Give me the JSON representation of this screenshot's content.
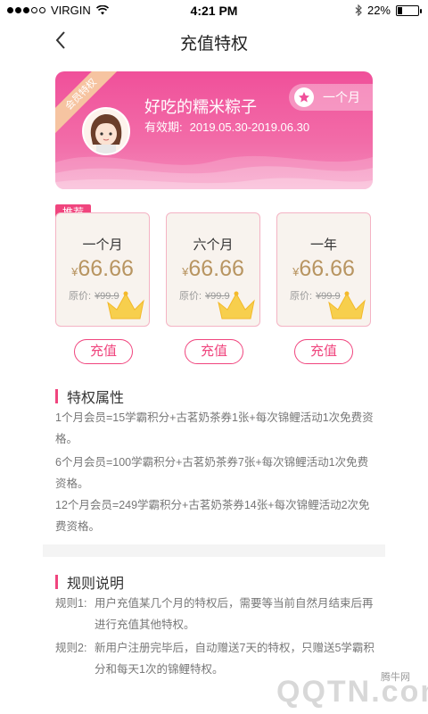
{
  "status": {
    "carrier": "VIRGIN",
    "time": "4:21 PM",
    "battery": "22%",
    "battery_level": 0.22
  },
  "nav": {
    "title": "充值特权"
  },
  "card": {
    "ribbon": "会员特权",
    "name": "好吃的糯米粽子",
    "valid_label": "有效期:",
    "valid_range": "2019.05.30-2019.06.30",
    "plan_label": "一个月"
  },
  "badge": "推荐",
  "plans": [
    {
      "name": "一个月",
      "currency": "¥",
      "price": "66.66",
      "orig_label": "原价:",
      "orig_price": "¥99.9",
      "button": "充值"
    },
    {
      "name": "六个月",
      "currency": "¥",
      "price": "66.66",
      "orig_label": "原价:",
      "orig_price": "¥99.9",
      "button": "充值"
    },
    {
      "name": "一年",
      "currency": "¥",
      "price": "66.66",
      "orig_label": "原价:",
      "orig_price": "¥99.9",
      "button": "充值"
    }
  ],
  "benefits": {
    "title": "特权属性",
    "lines": [
      "1个月会员=15学霸积分+古茗奶茶券1张+每次锦鲤活动1次免费资格。",
      "6个月会员=100学霸积分+古茗奶茶券7张+每次锦鲤活动1次免费资格。",
      "12个月会员=249学霸积分+古茗奶茶券14张+每次锦鲤活动2次免费资格。"
    ]
  },
  "rules": {
    "title": "规则说明",
    "items": [
      {
        "label": "规则1:",
        "text": "用户充值某几个月的特权后，需要等当前自然月结束后再进行充值其他特权。"
      },
      {
        "label": "规则2:",
        "text": "新用户注册完毕后，自动赠送7天的特权，只赠送5学霸积分和每天1次的锦鲤特权。"
      }
    ]
  },
  "watermark": {
    "small": "腾牛网",
    "big": "QQTN.com"
  },
  "colors": {
    "accent": "#f0457e",
    "gold": "#b89561",
    "card_pink": "#f0509a"
  }
}
